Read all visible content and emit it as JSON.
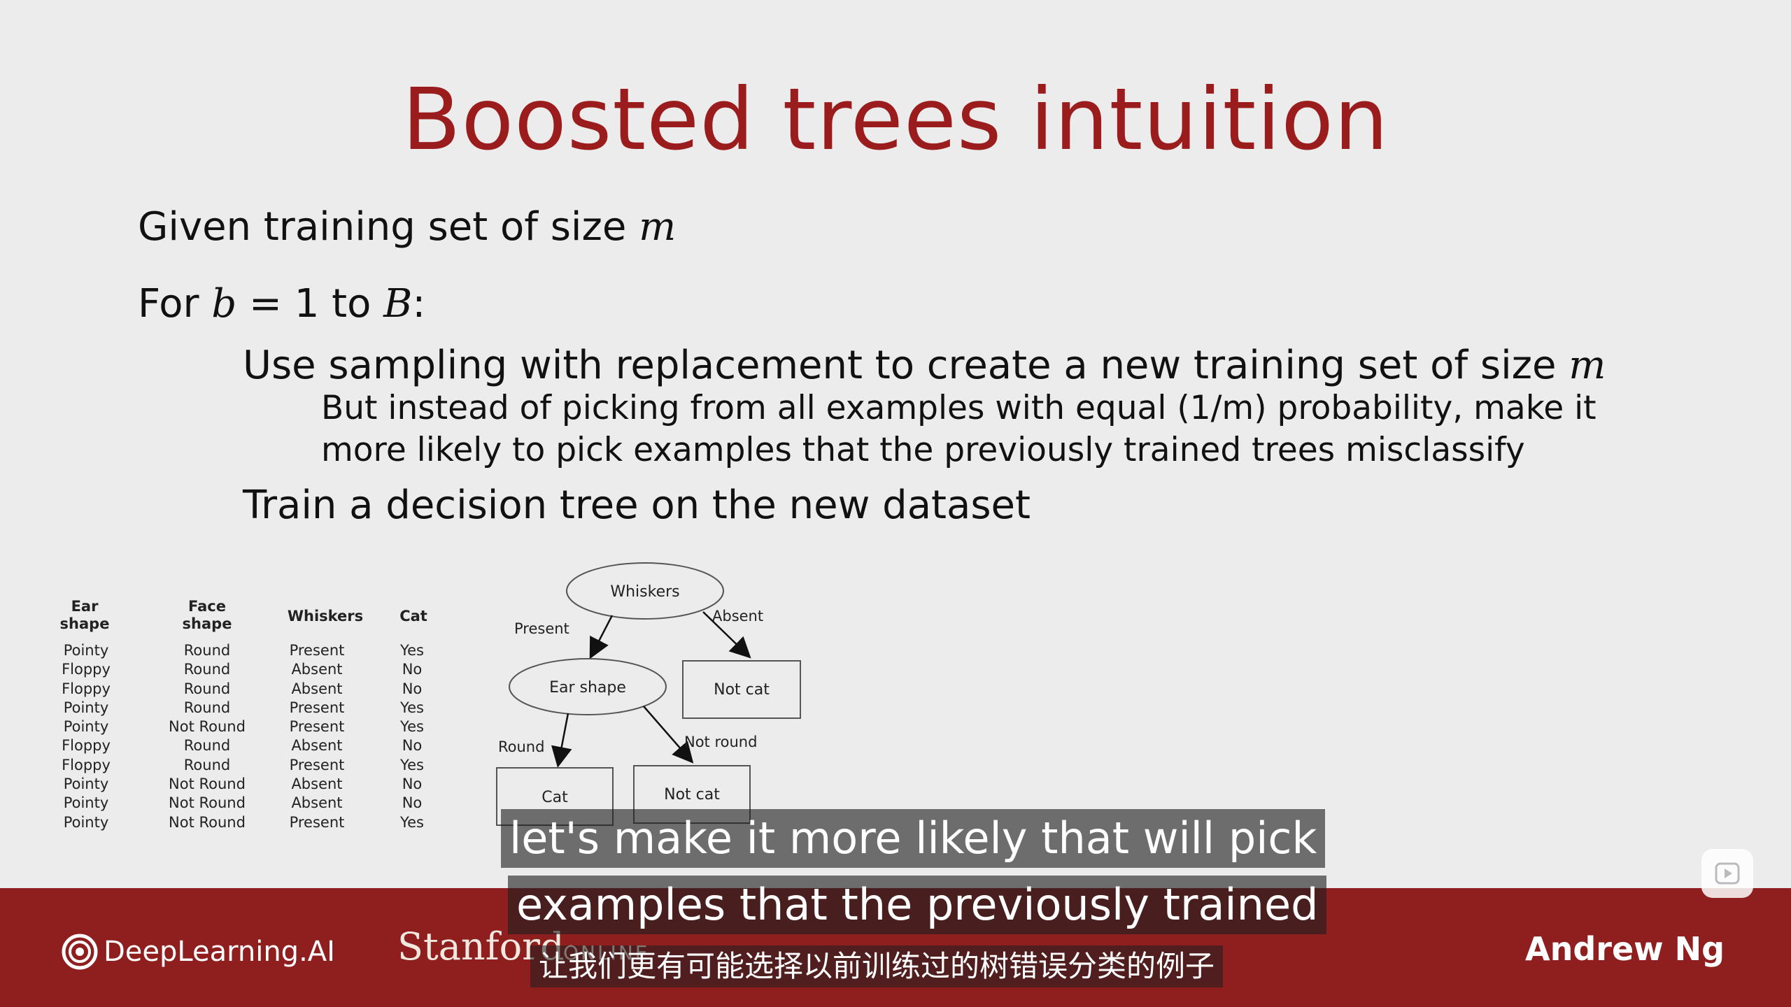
{
  "slide": {
    "title": "Boosted trees intuition",
    "line1_text": "Given training set of size ",
    "m": "m",
    "line2_prefix": "For ",
    "line2_b": "b",
    "line2_mid": " = 1 to ",
    "line2_B": "B",
    "line2_suffix": ":",
    "line3_text": "Use sampling with replacement to create a new training set of size ",
    "line4_text": "But instead of picking from all examples with equal (1/m) probability, make it",
    "line5_text": "more likely to pick examples that the previously trained trees misclassify",
    "line6_text": "Train a decision tree on the new dataset"
  },
  "table": {
    "headers": {
      "ear": [
        "Ear",
        "shape"
      ],
      "face": [
        "Face",
        "shape"
      ],
      "whiskers": "Whiskers",
      "cat": "Cat"
    },
    "ear_shape": [
      "Pointy",
      "Floppy",
      "Floppy",
      "Pointy",
      "Pointy",
      "Floppy",
      "Floppy",
      "Pointy",
      "Pointy",
      "Pointy"
    ],
    "face_shape": [
      "Round",
      "Round",
      "Round",
      "Round",
      "Not Round",
      "Round",
      "Round",
      "Not Round",
      "Not Round",
      "Not Round"
    ],
    "whiskers": [
      "Present",
      "Absent",
      "Absent",
      "Present",
      "Present",
      "Absent",
      "Present",
      "Absent",
      "Absent",
      "Present"
    ],
    "cat": [
      "Yes",
      "No",
      "No",
      "Yes",
      "Yes",
      "No",
      "Yes",
      "No",
      "No",
      "Yes"
    ]
  },
  "tree": {
    "root": "Whiskers",
    "left_edge": "Present",
    "right_edge": "Absent",
    "ear_node": "Ear shape",
    "not_cat_top": "Not cat",
    "round_edge": "Round",
    "not_round_edge": "Not round",
    "cat_leaf": "Cat",
    "not_cat_leaf": "Not cat"
  },
  "footer": {
    "deeplearning": "DeepLearning.AI",
    "stanford": "Stanford",
    "online": "ONLINE",
    "presenter": "Andrew Ng"
  },
  "subtitles": {
    "en_line1": "let's make it more likely that will pick",
    "en_line2": "examples that the previously trained",
    "zh_line": "让我们更有可能选择以前训练过的树错误分类的例子"
  },
  "colors": {
    "title": "#9b1c1c",
    "footer_bg": "#8f1f1f",
    "slide_bg": "#ececec"
  },
  "icons": {
    "play": "play-icon",
    "logo": "deeplearning-logo-icon"
  }
}
